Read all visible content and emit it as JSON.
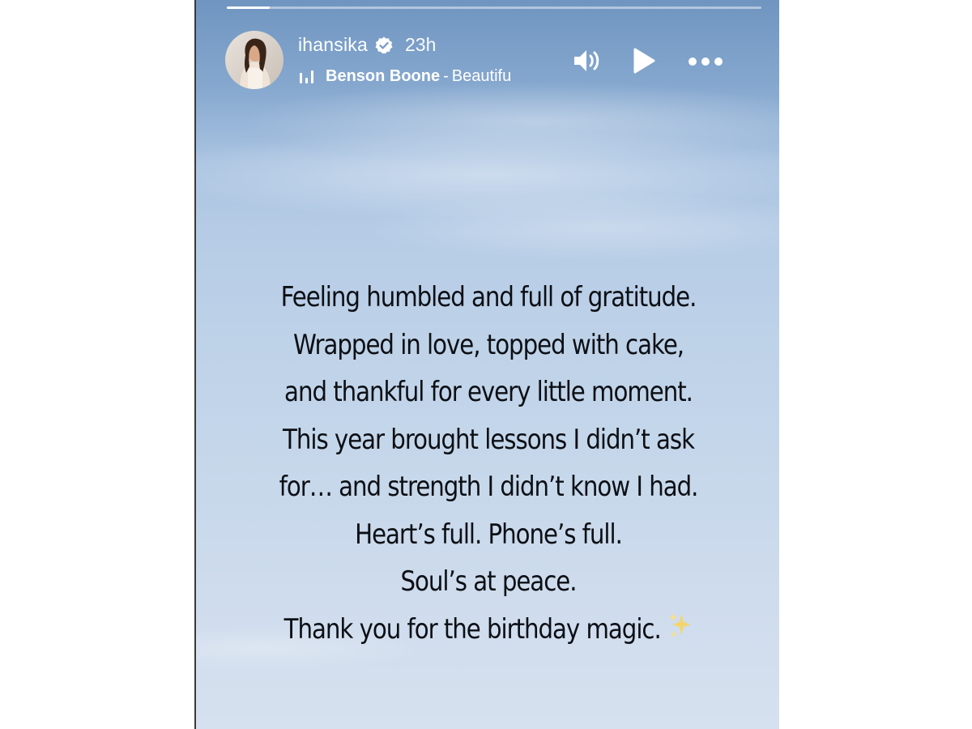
{
  "story": {
    "progress": 0.08,
    "user": {
      "username": "ihansika",
      "verified": true,
      "time_ago": "23h",
      "avatar_icon": "profile-photo"
    },
    "music": {
      "icon": "audio-bars-icon",
      "artist": "Benson Boone",
      "separator": "-",
      "song": "Beautifu"
    },
    "controls": {
      "volume_icon": "speaker-icon",
      "play_icon": "play-icon",
      "more_icon": "more-options-icon"
    },
    "caption": {
      "lines": [
        "Feeling humbled and full of gratitude.",
        "Wrapped in love, topped with cake,",
        "and thankful for every little moment.",
        "This year brought lessons I didn’t ask",
        "for… and strength I didn’t know I had.",
        "Heart’s full. Phone’s full.",
        "Soul’s at peace.",
        "Thank you for the birthday magic."
      ],
      "emoji_icon": "sparkles-icon"
    },
    "colors": {
      "sky_top": "#6f95c0",
      "sky_bottom": "#d6e1ef",
      "text": "#0c0f14",
      "header_text": "#ffffff",
      "sparkle": "#f3d56a"
    }
  }
}
